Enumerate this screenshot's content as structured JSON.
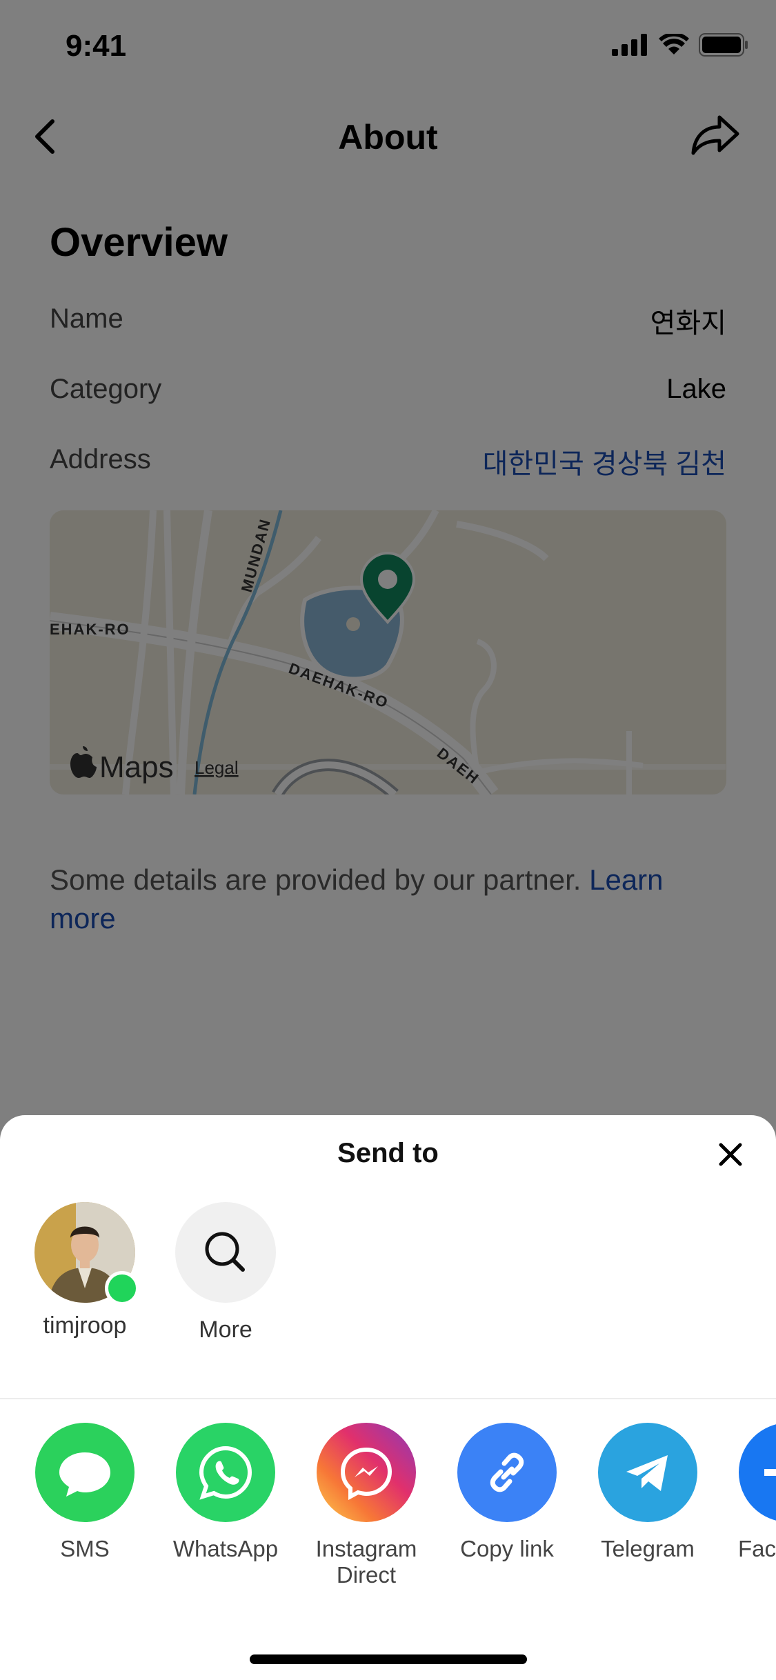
{
  "status_bar": {
    "time": "9:41"
  },
  "nav": {
    "title": "About"
  },
  "overview": {
    "heading": "Overview",
    "rows": [
      {
        "label": "Name",
        "value": "연화지"
      },
      {
        "label": "Category",
        "value": "Lake"
      },
      {
        "label": "Address",
        "value": "대한민국 경상북 김천"
      }
    ]
  },
  "map": {
    "brand": "Maps",
    "legal": "Legal",
    "street_labels": [
      "MUNDAN",
      "EHAK-RO",
      "DAEHAK-RO",
      "DAEH"
    ]
  },
  "disclaimer": {
    "text": "Some details are provided by our partner. ",
    "link": "Learn more"
  },
  "sheet": {
    "title": "Send to",
    "contacts": [
      {
        "label": "timjroop",
        "online": true
      },
      {
        "label": "More"
      }
    ],
    "apps": [
      {
        "label": "SMS",
        "icon": "sms-icon",
        "color": "#2bd15c"
      },
      {
        "label": "WhatsApp",
        "icon": "whatsapp-icon",
        "color": "#29d366"
      },
      {
        "label": "Instagram Direct",
        "icon": "messenger-icon",
        "color": "#e5368f"
      },
      {
        "label": "Copy link",
        "icon": "link-icon",
        "color": "#3b82f6"
      },
      {
        "label": "Telegram",
        "icon": "telegram-icon",
        "color": "#2aa3df"
      },
      {
        "label": "Face",
        "icon": "facebook-icon",
        "color": "#1877f2"
      }
    ]
  },
  "colors": {
    "accent_link": "#1a4db3",
    "online": "#20d45a",
    "pin": "#10895e"
  }
}
